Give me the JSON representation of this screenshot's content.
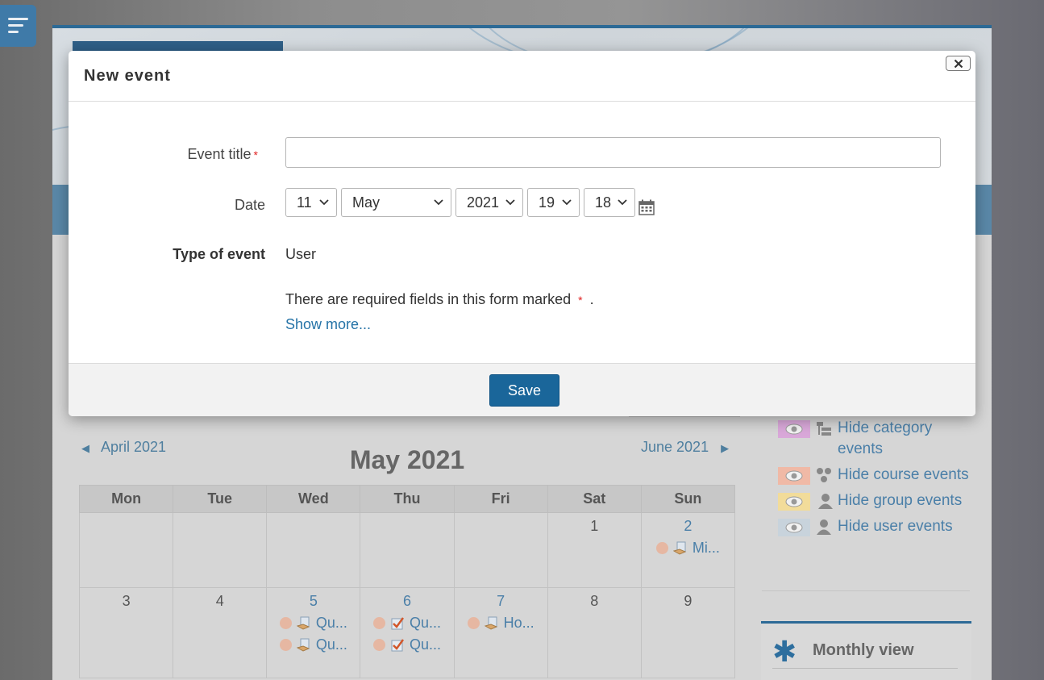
{
  "modal": {
    "title": "New event",
    "close_label": "Close",
    "fields": {
      "event_title_label": "Event title",
      "event_title_value": "",
      "date_label": "Date",
      "date": {
        "day": "11",
        "month": "May",
        "year": "2021",
        "hour": "19",
        "minute": "18"
      },
      "type_label": "Type of event",
      "type_value": "User"
    },
    "required_note_before": "There are required fields in this form marked",
    "required_note_after": ".",
    "required_marker": "*",
    "show_more": "Show more...",
    "save_label": "Save"
  },
  "calendar": {
    "prev_month": "April 2021",
    "next_month": "June 2021",
    "title": "May 2021",
    "weekdays": [
      "Mon",
      "Tue",
      "Wed",
      "Thu",
      "Fri",
      "Sat",
      "Sun"
    ],
    "week1": {
      "sat": "1",
      "sun": "2",
      "sun_event": "Mi..."
    },
    "week2": {
      "mon": "3",
      "tue": "4",
      "wed": "5",
      "thu": "6",
      "fri": "7",
      "sat": "8",
      "sun": "9",
      "wed_events": [
        "Qu...",
        "Qu..."
      ],
      "thu_events": [
        "Qu...",
        "Qu..."
      ],
      "fri_events": [
        "Ho..."
      ]
    }
  },
  "sidebar": {
    "filters": [
      {
        "label": "Hide category events",
        "color": "#d9a8d9"
      },
      {
        "label": "Hide course events",
        "color": "#f0b9a6"
      },
      {
        "label": "Hide group events",
        "color": "#f2dc9a"
      },
      {
        "label": "Hide user events",
        "color": "#c8d3dc"
      }
    ],
    "monthly_view": "Monthly view"
  },
  "colors": {
    "primary": "#1a669a",
    "link": "#2573a7",
    "required": "#e02020"
  }
}
